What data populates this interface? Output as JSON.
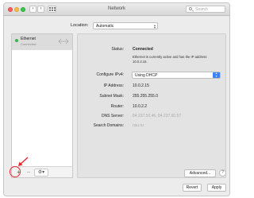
{
  "window": {
    "title": "Network"
  },
  "search": {
    "placeholder": "Search"
  },
  "location": {
    "label": "Location:",
    "value": "Automatic"
  },
  "sidebar": {
    "services": [
      {
        "name": "Ethernet",
        "status": "Connected",
        "status_color": "#39b54a"
      }
    ],
    "buttons": {
      "add": "+",
      "remove": "−",
      "gear": "⚙▾"
    }
  },
  "detail": {
    "status_label": "Status:",
    "status_value": "Connected",
    "status_desc": "Ethernet is currently active and has the IP address 10.0.2.15.",
    "configure_label": "Configure IPv4:",
    "configure_value": "Using DHCP",
    "ip_label": "IP Address:",
    "ip_value": "10.0.2.15",
    "subnet_label": "Subnet Mask:",
    "subnet_value": "255.255.255.0",
    "router_label": "Router:",
    "router_value": "10.0.2.2",
    "dns_label": "DNS Server:",
    "dns_value": "84.237.50.46, 84.237.60.57",
    "domains_label": "Search Domains:",
    "domains_value": "nsu.ru",
    "advanced_button": "Advanced...",
    "help_button": "?"
  },
  "footer": {
    "revert_button": "Revert",
    "apply_button": "Apply"
  },
  "colors": {
    "accent": "#3b84f5",
    "highlight": "#e6282c"
  }
}
